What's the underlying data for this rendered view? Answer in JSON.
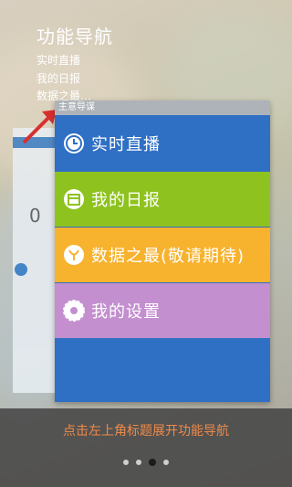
{
  "guide": {
    "title": "功能导航",
    "items": [
      "实时直播",
      "我的日报",
      "数据之最…"
    ]
  },
  "panel": {
    "header_label": "主意导谋",
    "menu": [
      {
        "label": "实时直播",
        "icon": "clock-icon",
        "color": "#2f6fc4"
      },
      {
        "label": "我的日报",
        "icon": "calendar-icon",
        "color": "#8ec31f"
      },
      {
        "label": "数据之最(敬请期待)",
        "icon": "trophy-icon",
        "color": "#f7b22e"
      },
      {
        "label": "我的设置",
        "icon": "gear-icon",
        "color": "#c38fcf"
      }
    ]
  },
  "left_preview": {
    "number": "0"
  },
  "hint": "点击左上角标题展开功能导航",
  "pager": {
    "count": 4,
    "active_index": 2
  }
}
